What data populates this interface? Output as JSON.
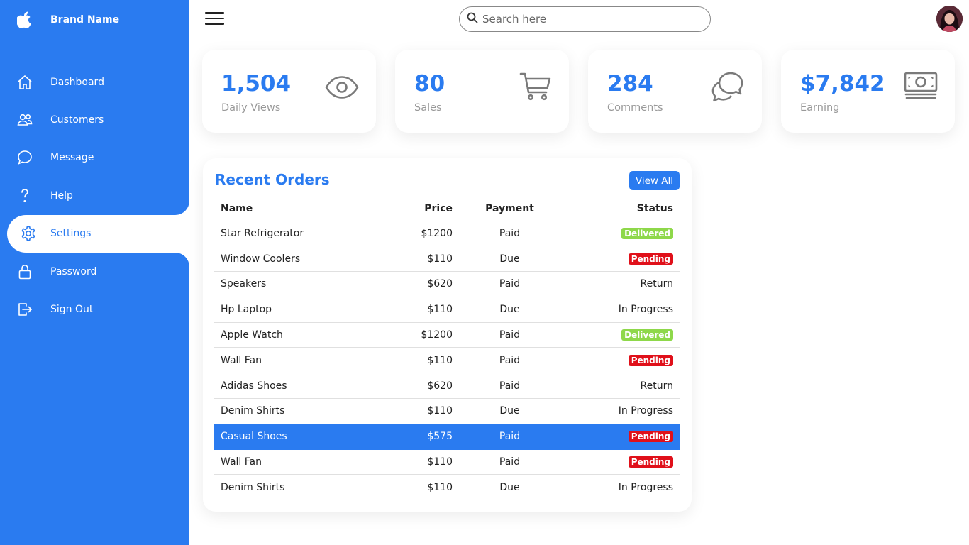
{
  "brand": {
    "name": "Brand Name",
    "icon": "apple-icon"
  },
  "nav": [
    {
      "label": "Dashboard",
      "icon": "home-icon"
    },
    {
      "label": "Customers",
      "icon": "people-icon"
    },
    {
      "label": "Message",
      "icon": "chat-icon"
    },
    {
      "label": "Help",
      "icon": "question-icon"
    },
    {
      "label": "Settings",
      "icon": "gear-icon",
      "active": true
    },
    {
      "label": "Password",
      "icon": "lock-icon"
    },
    {
      "label": "Sign Out",
      "icon": "signout-icon"
    }
  ],
  "search": {
    "placeholder": "Search here",
    "value": ""
  },
  "cards": [
    {
      "value": "1,504",
      "caption": "Daily Views",
      "icon": "eye-icon"
    },
    {
      "value": "80",
      "caption": "Sales",
      "icon": "cart-icon"
    },
    {
      "value": "284",
      "caption": "Comments",
      "icon": "comments-icon"
    },
    {
      "value": "$7,842",
      "caption": "Earning",
      "icon": "money-icon"
    }
  ],
  "orders": {
    "title": "Recent Orders",
    "view_all": "View All",
    "headers": {
      "name": "Name",
      "price": "Price",
      "payment": "Payment",
      "status": "Status"
    },
    "rows": [
      {
        "name": "Star Refrigerator",
        "price": "$1200",
        "payment": "Paid",
        "status": "Delivered"
      },
      {
        "name": "Window Coolers",
        "price": "$110",
        "payment": "Due",
        "status": "Pending"
      },
      {
        "name": "Speakers",
        "price": "$620",
        "payment": "Paid",
        "status": "Return"
      },
      {
        "name": "Hp Laptop",
        "price": "$110",
        "payment": "Due",
        "status": "In Progress"
      },
      {
        "name": "Apple Watch",
        "price": "$1200",
        "payment": "Paid",
        "status": "Delivered"
      },
      {
        "name": "Wall Fan",
        "price": "$110",
        "payment": "Paid",
        "status": "Pending"
      },
      {
        "name": "Adidas Shoes",
        "price": "$620",
        "payment": "Paid",
        "status": "Return"
      },
      {
        "name": "Denim Shirts",
        "price": "$110",
        "payment": "Due",
        "status": "In Progress"
      },
      {
        "name": "Casual Shoes",
        "price": "$575",
        "payment": "Paid",
        "status": "Pending",
        "selected": true
      },
      {
        "name": "Wall Fan",
        "price": "$110",
        "payment": "Paid",
        "status": "Pending"
      },
      {
        "name": "Denim Shirts",
        "price": "$110",
        "payment": "Due",
        "status": "In Progress"
      }
    ]
  },
  "colors": {
    "accent": "#2a7bf0",
    "delivered": "#8ed84a",
    "pending": "#e0101a"
  }
}
